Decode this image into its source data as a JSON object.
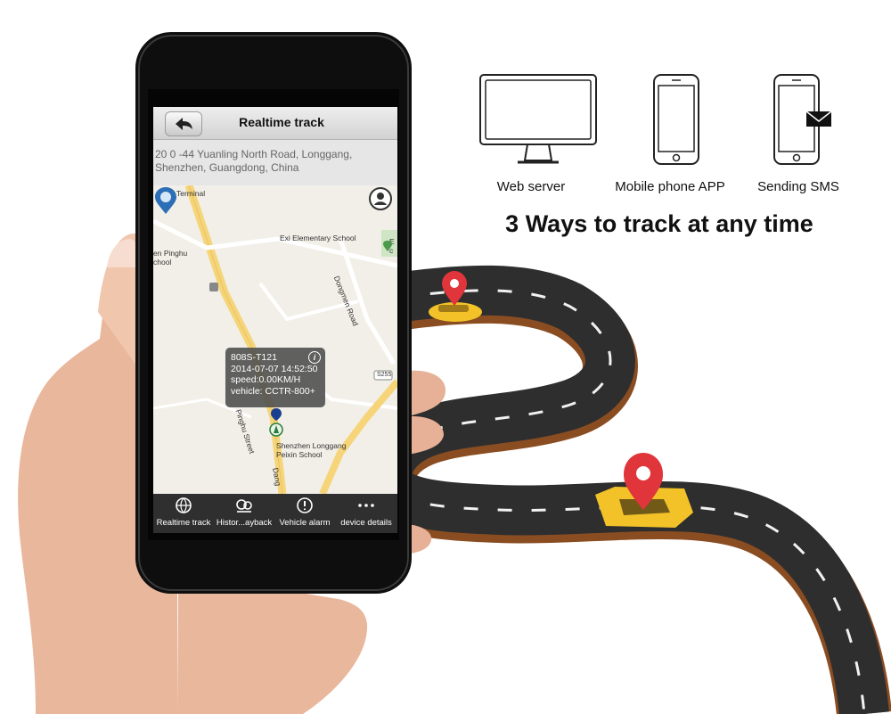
{
  "app": {
    "title": "Realtime track",
    "address": "20 0 -44 Yuanling North Road, Longgang, Shenzhen, Guangdong, China"
  },
  "map": {
    "labels": {
      "terminal": "Terminal",
      "exi_school": "Exi Elementary School",
      "pinghu_1": "en Pinghu",
      "pinghu_2": "chool",
      "dongmen": "Dongmen Road",
      "pinghu_street": "Pinghu Street",
      "longgang_1": "Shenzhen Longgang",
      "longgang_2": "Peixin School",
      "road_sign": "S255",
      "dang": "Dang",
      "edge_1": "E",
      "edge_2": "c"
    }
  },
  "popup": {
    "device_id": "808S-T121",
    "datetime": "2014-07-07 14:52:50",
    "speed": "speed:0.00KM/H",
    "vehicle": "vehicle: CCTR-800+"
  },
  "toolbar": {
    "items": [
      {
        "label": "Realtime track",
        "icon": "globe-icon"
      },
      {
        "label": "Histor...ayback",
        "icon": "film-reel-icon"
      },
      {
        "label": "Vehicle alarm",
        "icon": "alert-icon"
      },
      {
        "label": "device details",
        "icon": "more-dots-icon"
      }
    ]
  },
  "ways": {
    "headline": "3 Ways to track at any time",
    "items": [
      {
        "label": "Web server",
        "icon": "monitor-icon"
      },
      {
        "label": "Mobile phone APP",
        "icon": "smartphone-icon"
      },
      {
        "label": "Sending SMS",
        "icon": "sms-phone-icon"
      }
    ]
  },
  "colors": {
    "road": "#2e2e2e",
    "road_edge": "#8a4d22",
    "pin": "#e0353a",
    "taxi": "#f2c228",
    "phone_body": "#0e0e0e",
    "toolbar": "#2f2f2f"
  }
}
